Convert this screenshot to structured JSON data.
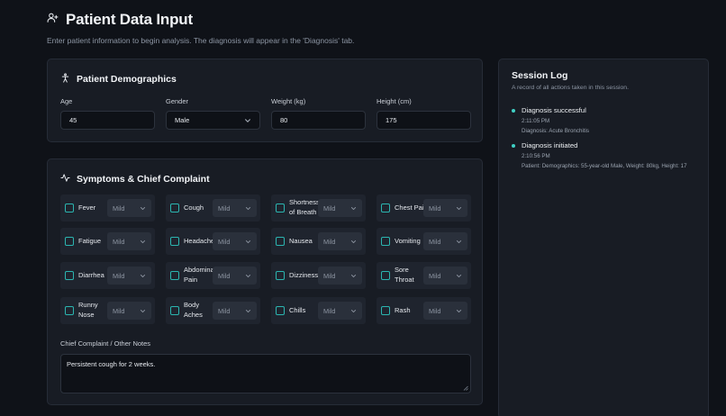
{
  "header": {
    "title": "Patient Data Input",
    "subtitle": "Enter patient information to begin analysis. The diagnosis will appear in the 'Diagnosis' tab."
  },
  "demographics": {
    "title": "Patient Demographics",
    "age": {
      "label": "Age",
      "value": "45"
    },
    "gender": {
      "label": "Gender",
      "value": "Male"
    },
    "weight": {
      "label": "Weight (kg)",
      "value": "80"
    },
    "height": {
      "label": "Height (cm)",
      "value": "175"
    }
  },
  "symptoms": {
    "title": "Symptoms & Chief Complaint",
    "items": [
      {
        "name": "Fever",
        "severity": "Mild"
      },
      {
        "name": "Cough",
        "severity": "Mild"
      },
      {
        "name": "Shortness of Breath",
        "severity": "Mild"
      },
      {
        "name": "Chest Pain",
        "severity": "Mild"
      },
      {
        "name": "Fatigue",
        "severity": "Mild"
      },
      {
        "name": "Headache",
        "severity": "Mild"
      },
      {
        "name": "Nausea",
        "severity": "Mild"
      },
      {
        "name": "Vomiting",
        "severity": "Mild"
      },
      {
        "name": "Diarrhea",
        "severity": "Mild"
      },
      {
        "name": "Abdominal Pain",
        "severity": "Mild"
      },
      {
        "name": "Dizziness",
        "severity": "Mild"
      },
      {
        "name": "Sore Throat",
        "severity": "Mild"
      },
      {
        "name": "Runny Nose",
        "severity": "Mild"
      },
      {
        "name": "Body Aches",
        "severity": "Mild"
      },
      {
        "name": "Chills",
        "severity": "Mild"
      },
      {
        "name": "Rash",
        "severity": "Mild"
      }
    ],
    "notes_label": "Chief Complaint / Other Notes",
    "notes_value": "Persistent cough for 2 weeks."
  },
  "session_log": {
    "title": "Session Log",
    "subtitle": "A record of all actions taken in this session.",
    "entries": [
      {
        "event": "Diagnosis successful",
        "time": "2:11:05 PM",
        "detail": "Diagnosis: Acute Bronchitis"
      },
      {
        "event": "Diagnosis initiated",
        "time": "2:10:56 PM",
        "detail": "Patient: Demographics: 55-year-old Male, Weight: 80kg, Height: 17"
      }
    ]
  },
  "colors": {
    "background": "#0f1218",
    "card": "#181c24",
    "accent": "#2bb5b0",
    "log_dot": "#3fd0c4"
  },
  "icons": {
    "title": "user-plus-icon",
    "demographics": "person-standing-icon",
    "symptoms": "activity-pulse-icon",
    "select": "chevron-down-icon"
  }
}
